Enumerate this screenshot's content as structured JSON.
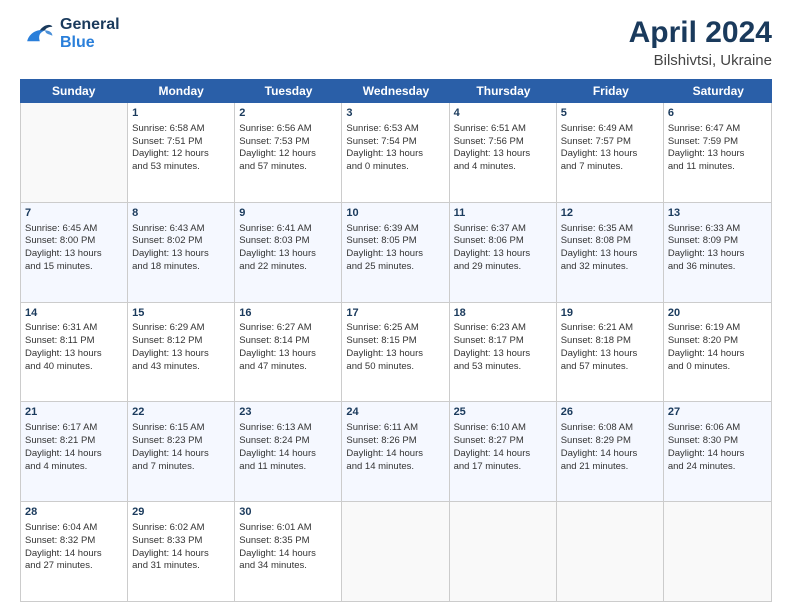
{
  "header": {
    "logo_general": "General",
    "logo_blue": "Blue",
    "title": "April 2024",
    "subtitle": "Bilshivtsi, Ukraine"
  },
  "days_of_week": [
    "Sunday",
    "Monday",
    "Tuesday",
    "Wednesday",
    "Thursday",
    "Friday",
    "Saturday"
  ],
  "weeks": [
    [
      {
        "day": "",
        "empty": true
      },
      {
        "day": "1",
        "rise": "Sunrise: 6:58 AM",
        "set": "Sunset: 7:51 PM",
        "daylight": "Daylight: 12 hours and 53 minutes."
      },
      {
        "day": "2",
        "rise": "Sunrise: 6:56 AM",
        "set": "Sunset: 7:53 PM",
        "daylight": "Daylight: 12 hours and 57 minutes."
      },
      {
        "day": "3",
        "rise": "Sunrise: 6:53 AM",
        "set": "Sunset: 7:54 PM",
        "daylight": "Daylight: 13 hours and 0 minutes."
      },
      {
        "day": "4",
        "rise": "Sunrise: 6:51 AM",
        "set": "Sunset: 7:56 PM",
        "daylight": "Daylight: 13 hours and 4 minutes."
      },
      {
        "day": "5",
        "rise": "Sunrise: 6:49 AM",
        "set": "Sunset: 7:57 PM",
        "daylight": "Daylight: 13 hours and 7 minutes."
      },
      {
        "day": "6",
        "rise": "Sunrise: 6:47 AM",
        "set": "Sunset: 7:59 PM",
        "daylight": "Daylight: 13 hours and 11 minutes."
      }
    ],
    [
      {
        "day": "7",
        "rise": "Sunrise: 6:45 AM",
        "set": "Sunset: 8:00 PM",
        "daylight": "Daylight: 13 hours and 15 minutes."
      },
      {
        "day": "8",
        "rise": "Sunrise: 6:43 AM",
        "set": "Sunset: 8:02 PM",
        "daylight": "Daylight: 13 hours and 18 minutes."
      },
      {
        "day": "9",
        "rise": "Sunrise: 6:41 AM",
        "set": "Sunset: 8:03 PM",
        "daylight": "Daylight: 13 hours and 22 minutes."
      },
      {
        "day": "10",
        "rise": "Sunrise: 6:39 AM",
        "set": "Sunset: 8:05 PM",
        "daylight": "Daylight: 13 hours and 25 minutes."
      },
      {
        "day": "11",
        "rise": "Sunrise: 6:37 AM",
        "set": "Sunset: 8:06 PM",
        "daylight": "Daylight: 13 hours and 29 minutes."
      },
      {
        "day": "12",
        "rise": "Sunrise: 6:35 AM",
        "set": "Sunset: 8:08 PM",
        "daylight": "Daylight: 13 hours and 32 minutes."
      },
      {
        "day": "13",
        "rise": "Sunrise: 6:33 AM",
        "set": "Sunset: 8:09 PM",
        "daylight": "Daylight: 13 hours and 36 minutes."
      }
    ],
    [
      {
        "day": "14",
        "rise": "Sunrise: 6:31 AM",
        "set": "Sunset: 8:11 PM",
        "daylight": "Daylight: 13 hours and 40 minutes."
      },
      {
        "day": "15",
        "rise": "Sunrise: 6:29 AM",
        "set": "Sunset: 8:12 PM",
        "daylight": "Daylight: 13 hours and 43 minutes."
      },
      {
        "day": "16",
        "rise": "Sunrise: 6:27 AM",
        "set": "Sunset: 8:14 PM",
        "daylight": "Daylight: 13 hours and 47 minutes."
      },
      {
        "day": "17",
        "rise": "Sunrise: 6:25 AM",
        "set": "Sunset: 8:15 PM",
        "daylight": "Daylight: 13 hours and 50 minutes."
      },
      {
        "day": "18",
        "rise": "Sunrise: 6:23 AM",
        "set": "Sunset: 8:17 PM",
        "daylight": "Daylight: 13 hours and 53 minutes."
      },
      {
        "day": "19",
        "rise": "Sunrise: 6:21 AM",
        "set": "Sunset: 8:18 PM",
        "daylight": "Daylight: 13 hours and 57 minutes."
      },
      {
        "day": "20",
        "rise": "Sunrise: 6:19 AM",
        "set": "Sunset: 8:20 PM",
        "daylight": "Daylight: 14 hours and 0 minutes."
      }
    ],
    [
      {
        "day": "21",
        "rise": "Sunrise: 6:17 AM",
        "set": "Sunset: 8:21 PM",
        "daylight": "Daylight: 14 hours and 4 minutes."
      },
      {
        "day": "22",
        "rise": "Sunrise: 6:15 AM",
        "set": "Sunset: 8:23 PM",
        "daylight": "Daylight: 14 hours and 7 minutes."
      },
      {
        "day": "23",
        "rise": "Sunrise: 6:13 AM",
        "set": "Sunset: 8:24 PM",
        "daylight": "Daylight: 14 hours and 11 minutes."
      },
      {
        "day": "24",
        "rise": "Sunrise: 6:11 AM",
        "set": "Sunset: 8:26 PM",
        "daylight": "Daylight: 14 hours and 14 minutes."
      },
      {
        "day": "25",
        "rise": "Sunrise: 6:10 AM",
        "set": "Sunset: 8:27 PM",
        "daylight": "Daylight: 14 hours and 17 minutes."
      },
      {
        "day": "26",
        "rise": "Sunrise: 6:08 AM",
        "set": "Sunset: 8:29 PM",
        "daylight": "Daylight: 14 hours and 21 minutes."
      },
      {
        "day": "27",
        "rise": "Sunrise: 6:06 AM",
        "set": "Sunset: 8:30 PM",
        "daylight": "Daylight: 14 hours and 24 minutes."
      }
    ],
    [
      {
        "day": "28",
        "rise": "Sunrise: 6:04 AM",
        "set": "Sunset: 8:32 PM",
        "daylight": "Daylight: 14 hours and 27 minutes."
      },
      {
        "day": "29",
        "rise": "Sunrise: 6:02 AM",
        "set": "Sunset: 8:33 PM",
        "daylight": "Daylight: 14 hours and 31 minutes."
      },
      {
        "day": "30",
        "rise": "Sunrise: 6:01 AM",
        "set": "Sunset: 8:35 PM",
        "daylight": "Daylight: 14 hours and 34 minutes."
      },
      {
        "day": "",
        "empty": true
      },
      {
        "day": "",
        "empty": true
      },
      {
        "day": "",
        "empty": true
      },
      {
        "day": "",
        "empty": true
      }
    ]
  ]
}
